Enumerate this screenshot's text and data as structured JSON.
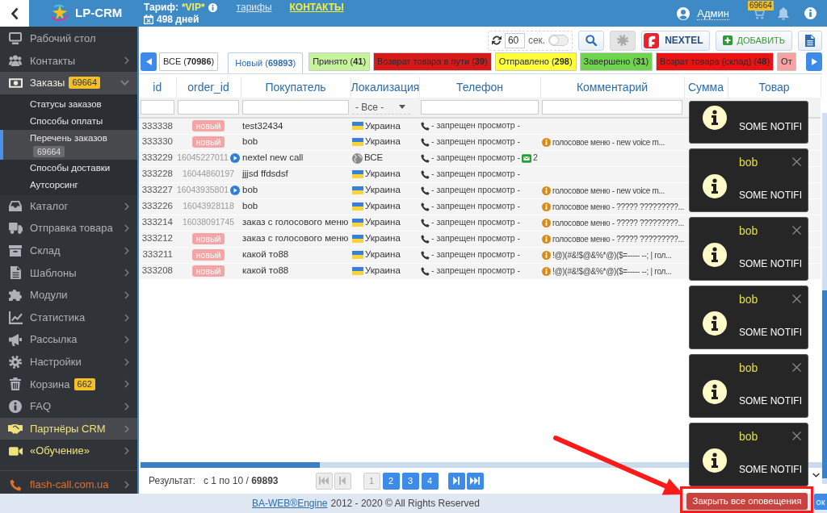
{
  "logo": {
    "text": "LP-CRM"
  },
  "header": {
    "tariff_label": "Тариф:",
    "tariff": "*VIP*",
    "tariffs_link": "тарифы",
    "contacts_link": "КОНТАКТЫ",
    "days": "498 дней",
    "user": "Админ",
    "cart_count": "69664"
  },
  "sidebar": {
    "items": [
      {
        "label": "Рабочий стол",
        "highlighted": false
      },
      {
        "label": "Контакты",
        "highlighted": false,
        "expanded": false
      },
      {
        "label": "Заказы",
        "badge": "69664",
        "highlighted": true,
        "expanded": true,
        "children": [
          {
            "label": "Статусы заказов",
            "selected": false
          },
          {
            "label": "Способы оплаты",
            "selected": false
          },
          {
            "label": "Перечень заказов",
            "badge": "69664",
            "selected": true
          },
          {
            "label": "Способы доставки",
            "selected": false
          },
          {
            "label": "Аутсорсинг",
            "selected": false
          }
        ]
      },
      {
        "label": "Каталог",
        "highlighted": false,
        "expanded": false
      },
      {
        "label": "Отправка товара",
        "highlighted": false,
        "expanded": false
      },
      {
        "label": "Склад",
        "highlighted": false,
        "expanded": false
      },
      {
        "label": "Шаблоны",
        "highlighted": false,
        "expanded": false
      },
      {
        "label": "Модули",
        "highlighted": false,
        "expanded": false
      },
      {
        "label": "Статистика",
        "highlighted": false,
        "expanded": false
      },
      {
        "label": "Рассылка",
        "highlighted": false,
        "expanded": false
      },
      {
        "label": "Настройки",
        "highlighted": false,
        "expanded": false
      },
      {
        "label": "Корзина",
        "badge": "662",
        "highlighted": false,
        "expanded": false
      },
      {
        "label": "FAQ",
        "highlighted": false,
        "expanded": false
      },
      {
        "label": "Партнёры CRM",
        "highlighted": true,
        "expanded": false,
        "color": "#efe27a"
      },
      {
        "label": "«Обучение»",
        "highlighted": false,
        "expanded": false,
        "color": "#efe27a"
      }
    ],
    "links": [
      {
        "label": "flash-call.com.ua",
        "expanded": false,
        "color": "#e0702a"
      }
    ]
  },
  "toolbar": {
    "interval": "60",
    "unit": "сек.",
    "auto_refresh": false,
    "buttons": [
      {
        "kind": "search",
        "disabled": false
      },
      {
        "kind": "settings",
        "disabled": true
      },
      {
        "kind": "nextel",
        "label": "NEXTEL",
        "disabled": false
      },
      {
        "kind": "add",
        "label": "ДОБАВИТЬ",
        "disabled": false
      },
      {
        "kind": "document",
        "disabled": false
      }
    ]
  },
  "tabs": [
    {
      "label": "ВСЕ (**70986**)",
      "selected": false,
      "color": "#ffffff"
    },
    {
      "label": "Новый (**69893**)",
      "selected": true,
      "color": "#ffffff"
    },
    {
      "label": "Принято (**41**)",
      "selected": false,
      "color": "#c6f39b"
    },
    {
      "label": "Возврат товара в пути (**39**)",
      "selected": false,
      "color": "#d61a1a"
    },
    {
      "label": "Отправлено (**298**)",
      "selected": false,
      "color": "#ffff3a"
    },
    {
      "label": "Завершено (**31**)",
      "selected": false,
      "color": "#6fd34f"
    },
    {
      "label": "Возрат товара (склад) (**48**)",
      "selected": false,
      "color": "#ea1212"
    },
    {
      "label": "От",
      "selected": false,
      "color": "#f7a1a1"
    }
  ],
  "table": {
    "columns": [
      {
        "label": "id",
        "filter": {
          "kind": "text"
        }
      },
      {
        "label": "order_id",
        "filter": {
          "kind": "text"
        }
      },
      {
        "label": "Покупатель",
        "filter": {
          "kind": "text"
        }
      },
      {
        "label": "Локализация",
        "filter": {
          "kind": "select",
          "value": "- Все -"
        }
      },
      {
        "label": "Телефон",
        "filter": {
          "kind": "text"
        }
      },
      {
        "label": "Комментарий",
        "filter": {
          "kind": "text"
        }
      },
      {
        "label": "Сумма"
      },
      {
        "label": "Товар"
      }
    ],
    "rows": [
      {
        "id": "333338",
        "order": {
          "kind": "badge",
          "text": "новый",
          "audio": false
        },
        "customer": "test32434",
        "location": {
          "kind": "flag",
          "text": "Украина"
        },
        "phone": "- запрещен просмотр -"
      },
      {
        "id": "333330",
        "order": {
          "kind": "badge",
          "text": "новый",
          "audio": false
        },
        "customer": "bob",
        "location": {
          "kind": "flag",
          "text": "Украина"
        },
        "phone": "- запрещен просмотр -",
        "comment": "голосовое меню - new voice m..."
      },
      {
        "id": "333229",
        "order": {
          "kind": "number",
          "text": "16045227011",
          "audio": true
        },
        "customer": "nextel new call",
        "location": {
          "kind": "globe",
          "text": "ВСЕ"
        },
        "phone": "- запрещен просмотр -",
        "messages": "2"
      },
      {
        "id": "333228",
        "order": {
          "kind": "number",
          "text": "16044860197",
          "audio": false
        },
        "customer": "jjjsd ffdsdsf",
        "location": {
          "kind": "flag",
          "text": "Украина"
        },
        "phone": "- запрещен просмотр -"
      },
      {
        "id": "333227",
        "order": {
          "kind": "number",
          "text": "16043935801",
          "audio": true
        },
        "customer": "bob",
        "location": {
          "kind": "flag",
          "text": "Украина"
        },
        "phone": "- запрещен просмотр -",
        "comment": "голосовое меню - new voice m..."
      },
      {
        "id": "333226",
        "order": {
          "kind": "number",
          "text": "16043928118",
          "audio": false
        },
        "customer": "bob",
        "location": {
          "kind": "flag",
          "text": "Украина"
        },
        "phone": "- запрещен просмотр -",
        "comment": "голосовое меню - ????? ?????????..."
      },
      {
        "id": "333214",
        "order": {
          "kind": "number",
          "text": "16038091745",
          "audio": false
        },
        "customer": "заказ с голосового меню",
        "location": {
          "kind": "flag",
          "text": "Украина"
        },
        "phone": "- запрещен просмотр -",
        "comment": "голосовое меню - ????? ?????????..."
      },
      {
        "id": "333212",
        "order": {
          "kind": "badge",
          "text": "новый",
          "audio": false
        },
        "customer": "заказ с голосового меню",
        "location": {
          "kind": "flag",
          "text": "Украина"
        },
        "phone": "- запрещен просмотр -",
        "comment": "голосовое меню - ????? ?????????..."
      },
      {
        "id": "333211",
        "order": {
          "kind": "badge",
          "text": "новый",
          "audio": false
        },
        "customer": "какой то88",
        "location": {
          "kind": "flag",
          "text": "Украина"
        },
        "phone": "- запрещен просмотр -",
        "comment": "!@)(#&!$@&%*@)($=----- --; | гол..."
      },
      {
        "id": "333208",
        "order": {
          "kind": "badge",
          "text": "новый",
          "audio": false
        },
        "customer": "какой то88",
        "location": {
          "kind": "flag",
          "text": "Украина"
        },
        "phone": "- запрещен просмотр -",
        "comment": "!@)(#&!$@&%*@)($=----- --; | гол..."
      }
    ]
  },
  "pagination": {
    "label": "Результат:",
    "range": "с 1 по 10 / **69893**",
    "nav_start": [
      {
        "kind": "first",
        "disabled": true
      },
      {
        "kind": "prev",
        "disabled": true
      }
    ],
    "pages": [
      {
        "label": "1",
        "selected": true
      },
      {
        "label": "2",
        "selected": false
      },
      {
        "label": "3",
        "selected": false
      },
      {
        "label": "4",
        "selected": false
      }
    ],
    "nav_end": [
      {
        "kind": "next",
        "disabled": false
      },
      {
        "kind": "last",
        "disabled": false
      }
    ]
  },
  "footer": {
    "link": "BA-WEB®Engine",
    "text": "2012 - 2020 © All Rights Reserved",
    "button": "ок"
  },
  "notifications": {
    "items": [
      {
        "message": "SOME NOTIFI"
      },
      {
        "title": "bob",
        "message": "SOME NOTIFI"
      },
      {
        "title": "bob",
        "message": "SOME NOTIFI"
      },
      {
        "title": "bob",
        "message": "SOME NOTIFI"
      },
      {
        "title": "bob",
        "message": "SOME NOTIFI"
      },
      {
        "title": "bob",
        "message": "SOME NOTIFI"
      }
    ],
    "close_all": "Закрыть все оповещения"
  }
}
